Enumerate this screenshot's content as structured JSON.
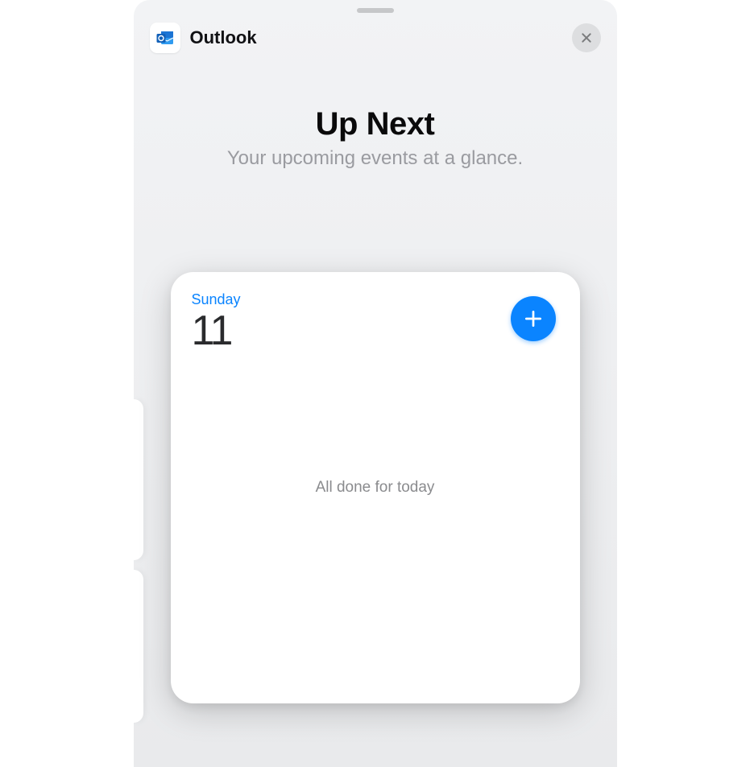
{
  "header": {
    "app_name": "Outlook"
  },
  "main": {
    "title": "Up Next",
    "subtitle": "Your upcoming events at a glance."
  },
  "widget": {
    "day_name": "Sunday",
    "day_number": "11",
    "status": "All done for today"
  },
  "colors": {
    "accent": "#0a84ff"
  }
}
